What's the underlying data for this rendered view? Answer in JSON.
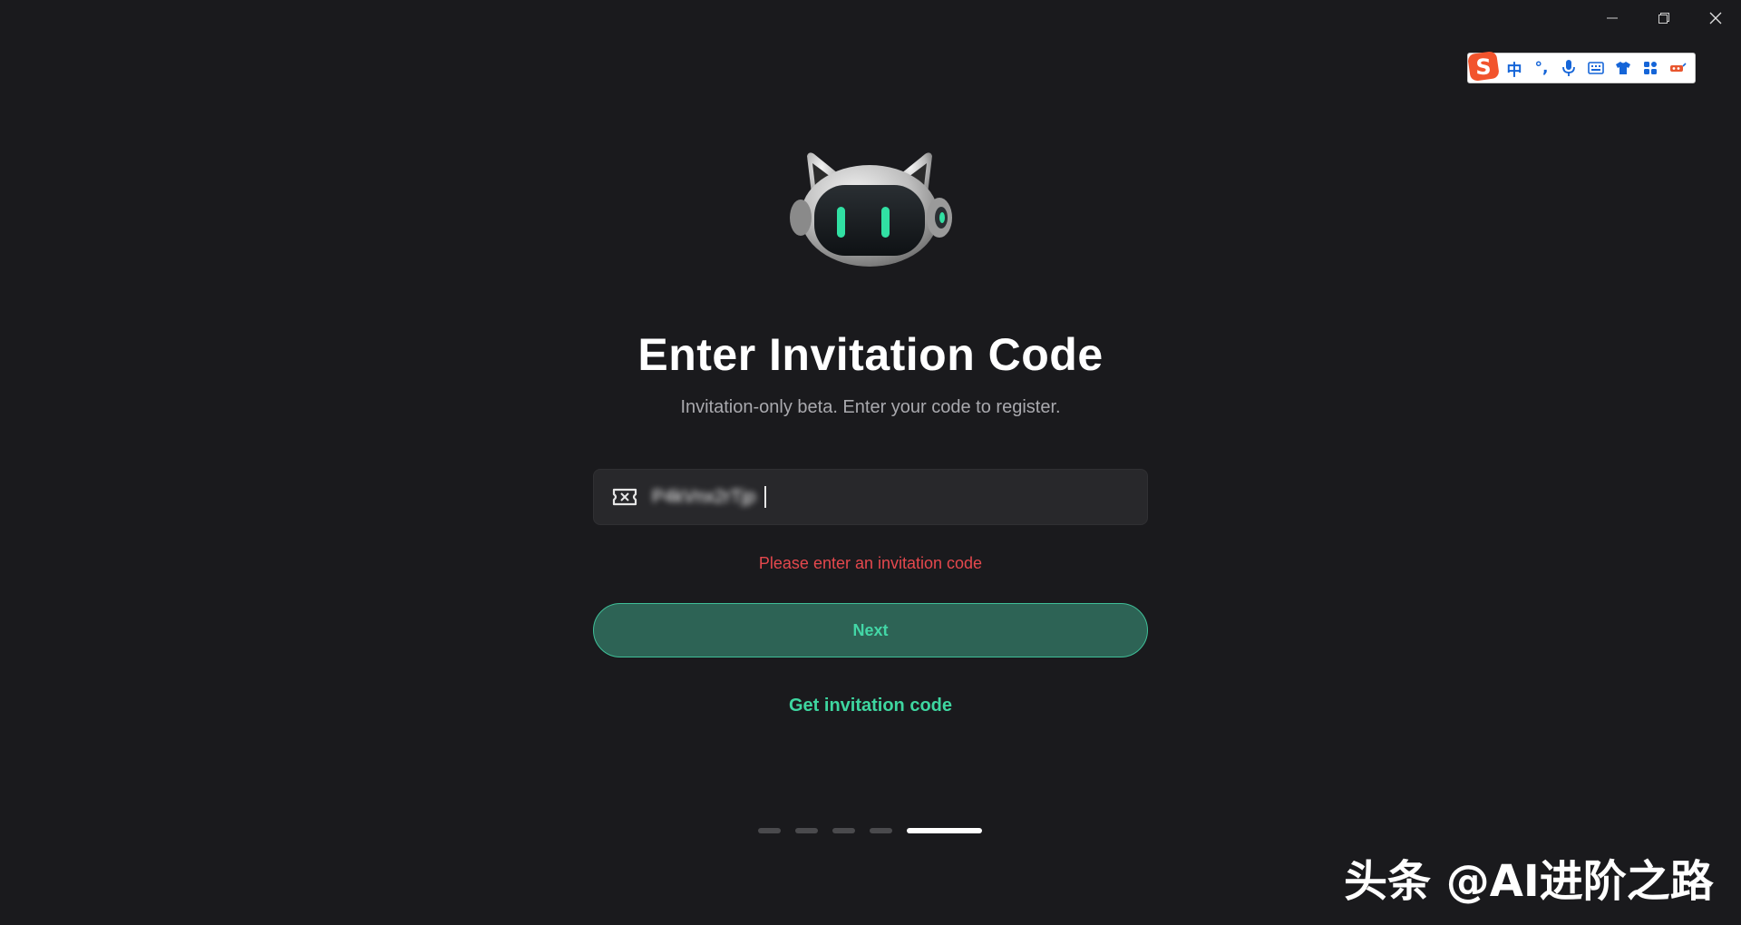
{
  "window": {
    "controls": [
      "minimize",
      "restore",
      "close"
    ]
  },
  "ime_toolbar": {
    "items": [
      "中",
      "°,"
    ],
    "icons": [
      "sogou-logo-icon",
      "microphone-icon",
      "keyboard-icon",
      "shirt-icon",
      "grid-apps-icon",
      "tools-icon"
    ]
  },
  "page": {
    "title": "Enter Invitation Code",
    "subtitle": "Invitation-only beta. Enter your code to register.",
    "code_value": "P4kVnx2rTjp",
    "error": "Please enter an invitation code",
    "next_label": "Next",
    "get_code_label": "Get invitation code"
  },
  "pager": {
    "total": 5,
    "active_index": 4
  },
  "watermark": "头条 @AI进阶之路",
  "colors": {
    "background": "#1a1a1d",
    "accent": "#3ed6a0",
    "button_fill": "#2d6355",
    "error": "#e5484d"
  }
}
